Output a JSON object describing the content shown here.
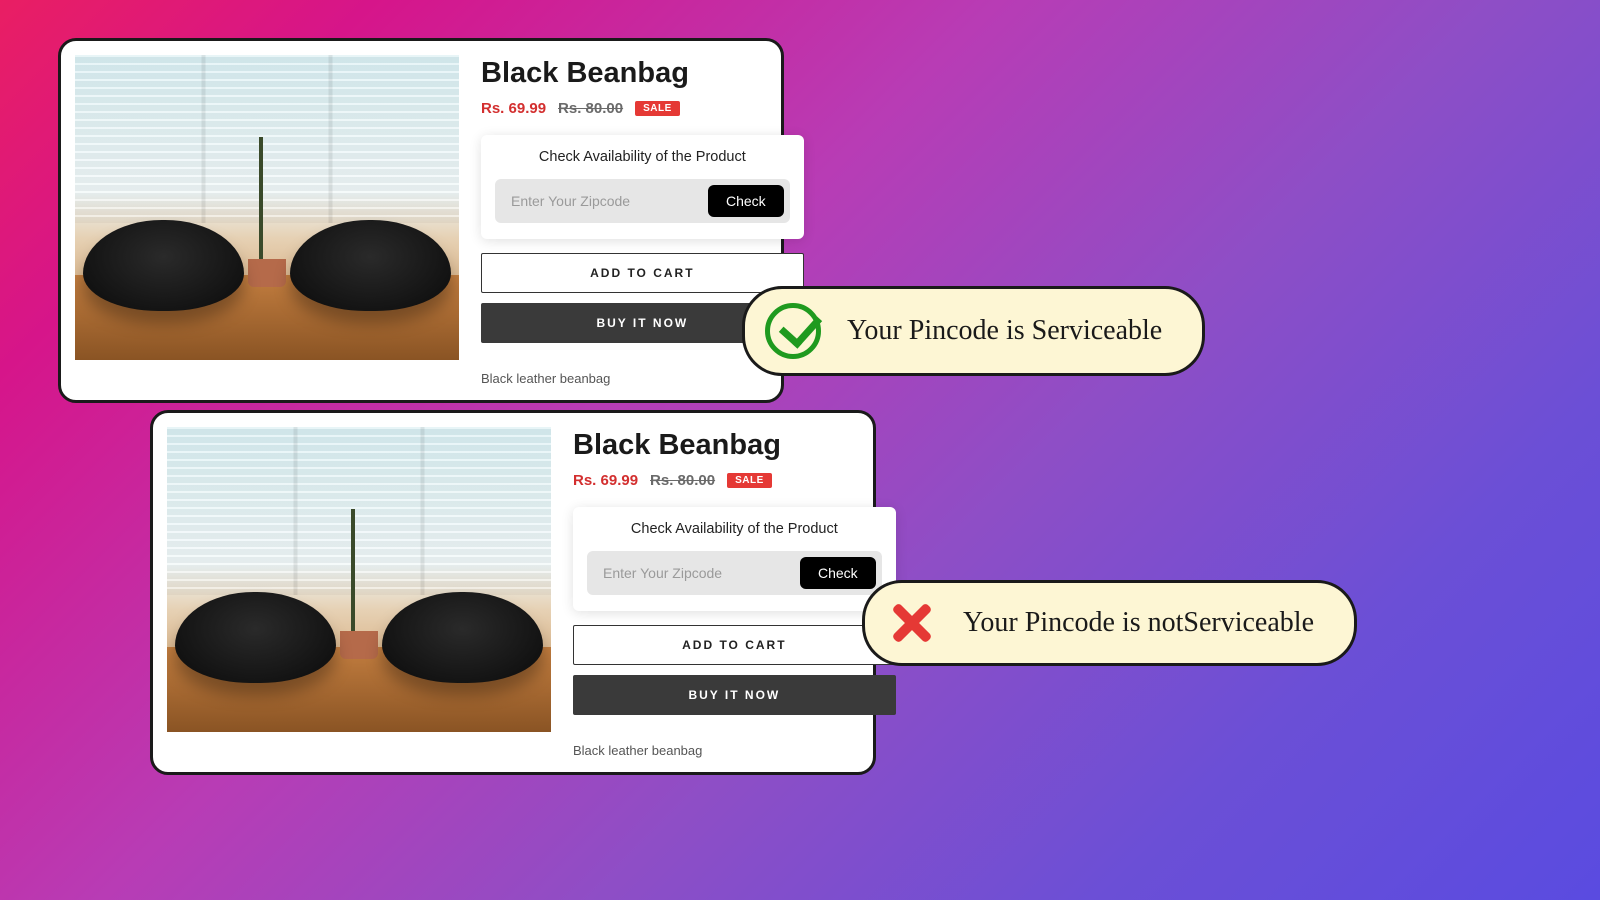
{
  "card_a": {
    "title": "Black Beanbag",
    "price_sale": "Rs. 69.99",
    "price_original": "Rs. 80.00",
    "sale_label": "SALE",
    "availability_heading": "Check Availability of the Product",
    "zip_placeholder": "Enter Your Zipcode",
    "check_label": "Check",
    "add_to_cart_label": "ADD TO CART",
    "buy_now_label": "BUY IT NOW",
    "description": "Black leather beanbag"
  },
  "card_b": {
    "title": "Black Beanbag",
    "price_sale": "Rs. 69.99",
    "price_original": "Rs. 80.00",
    "sale_label": "SALE",
    "availability_heading": "Check Availability of the Product",
    "zip_placeholder": "Enter Your Zipcode",
    "check_label": "Check",
    "add_to_cart_label": "ADD TO CART",
    "buy_now_label": "BUY IT NOW",
    "description": "Black leather beanbag"
  },
  "toast_success": "Your Pincode is Serviceable",
  "toast_fail": "Your Pincode is notServiceable"
}
